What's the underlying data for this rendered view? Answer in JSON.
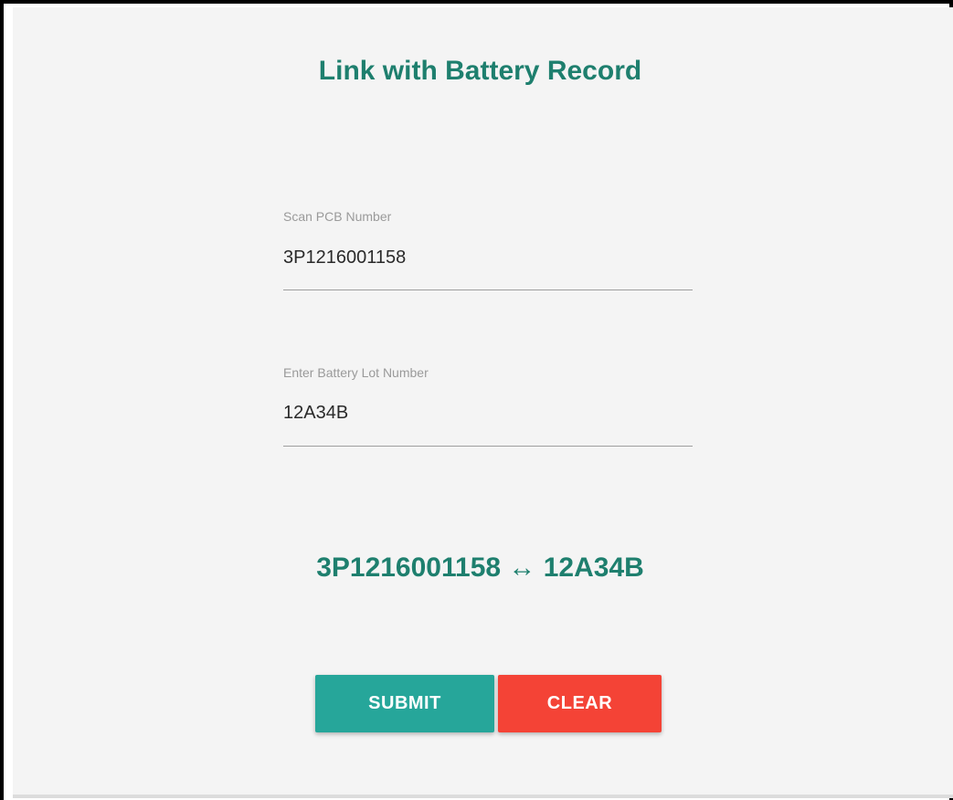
{
  "form": {
    "title": "Link with Battery Record",
    "pcb_field": {
      "label": "Scan PCB Number",
      "value": "3P1216001158"
    },
    "lot_field": {
      "label": "Enter Battery Lot Number",
      "value": "12A34B"
    },
    "link_summary": "3P1216001158 ↔ 12A34B",
    "buttons": {
      "submit_label": "SUBMIT",
      "clear_label": "CLEAR"
    }
  },
  "colors": {
    "accent": "#1e7f6e",
    "submit": "#26a69a",
    "clear": "#f44336",
    "background": "#f4f4f4"
  }
}
